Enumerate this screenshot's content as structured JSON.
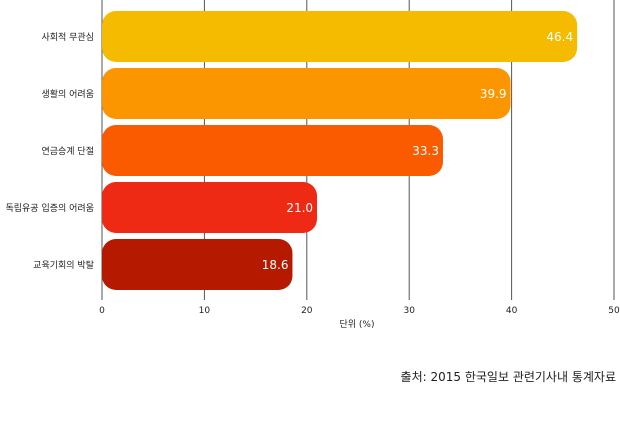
{
  "chart_data": {
    "type": "bar",
    "orientation": "horizontal",
    "categories": [
      "사회적 무관심",
      "생활의 어려움",
      "연금승계 단절",
      "독립유공 입증의 어려움",
      "교육기회의 박탈"
    ],
    "values": [
      46.4,
      39.9,
      33.3,
      21.0,
      18.6
    ],
    "value_labels": [
      "46.4",
      "39.9",
      "33.3",
      "21.0",
      "18.6"
    ],
    "bar_colors": [
      "#f5bb00",
      "#fb9600",
      "#fb5b00",
      "#ee2914",
      "#b51a00"
    ],
    "xlabel": "단위 (%)",
    "xlim": [
      0,
      50
    ],
    "xticks": [
      "0",
      "10",
      "20",
      "30",
      "40",
      "50"
    ],
    "grid": "vertical lines",
    "gridline_color": "#555555",
    "label_color": "#ffffff"
  },
  "source": "출처: 2015 한국일보 관련기사내 통계자료"
}
